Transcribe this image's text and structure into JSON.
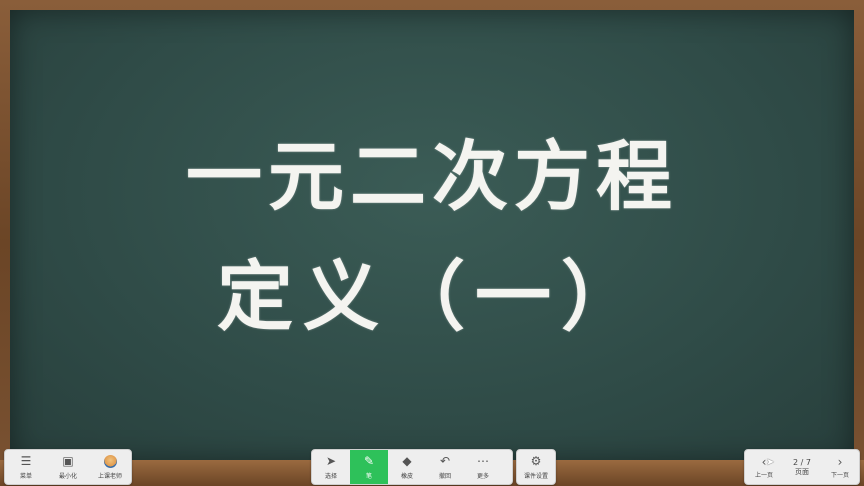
{
  "board": {
    "title_line1": "一元二次方程",
    "title_line2": "定义（一）"
  },
  "toolbar_left": {
    "menu_label": "菜单",
    "minimize_label": "最小化",
    "teacher_label": "上课老师"
  },
  "toolbar_center": {
    "select_label": "选择",
    "pen_label": "笔",
    "eraser_label": "橡皮",
    "undo_label": "撤回",
    "more_label": "更多"
  },
  "toolbar_setting": {
    "settings_label": "课件设置"
  },
  "toolbar_right": {
    "prev_label": "上一页",
    "page_indicator": "2 / 7",
    "current_label": "页面",
    "next_label": "下一页"
  },
  "colors": {
    "board": "#2f4b47",
    "frame": "#6e4a2c",
    "active": "#2ec15a"
  }
}
